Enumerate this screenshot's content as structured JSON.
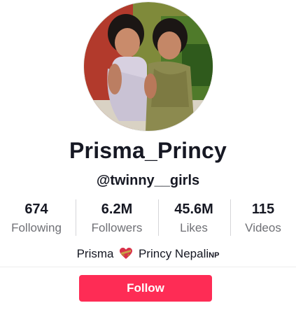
{
  "profile": {
    "display_name": "Prisma_Princy",
    "username": "@twinny__girls",
    "avatar_icon": "profile-photo-avatar"
  },
  "stats": [
    {
      "value": "674",
      "label": "Following"
    },
    {
      "value": "6.2M",
      "label": "Followers"
    },
    {
      "value": "45.6M",
      "label": "Likes"
    },
    {
      "value": "115",
      "label": "Videos"
    }
  ],
  "bio": {
    "first_name": "Prisma",
    "emoji": "heart-with-ribbon-icon",
    "second_text": "Princy Nepali",
    "flag_text": "NP"
  },
  "actions": {
    "follow_label": "Follow"
  },
  "colors": {
    "accent": "#fe2c55",
    "text_primary": "#161823",
    "text_secondary": "#6f7075",
    "divider": "#d5d5d8"
  }
}
